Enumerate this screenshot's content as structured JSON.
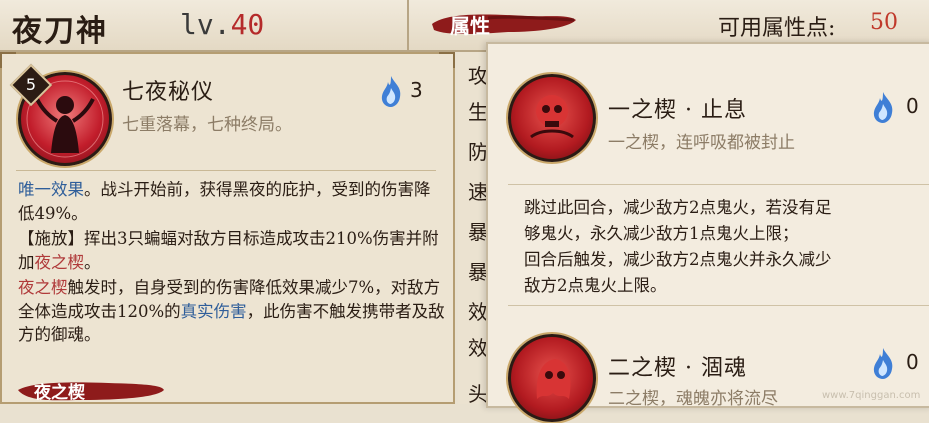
{
  "header": {
    "character_name": "夜刀神",
    "level_label": "lv.",
    "level_value": "40",
    "attributes_tab": "属性",
    "available_points_label": "可用属性点:",
    "available_points_value": "50"
  },
  "skill": {
    "level": "5",
    "name": "七夜秘仪",
    "subtitle": "七重落幕，七种终局。",
    "cost": "3",
    "desc1_keyword": "唯一效果",
    "desc1_rest": "。战斗开始前，获得黑夜的庇护，受到的伤害降低49%。",
    "desc2_a": "【施放】挥出3只蝙蝠对敌方目标造成攻击210%伤害并附加",
    "desc2_keyword": "夜之楔",
    "desc2_b": "。",
    "desc3_keyword": "夜之楔",
    "desc3_a": "触发时，自身受到的伤害降低效果减少7%，对敌方全体造成攻击120%的",
    "desc3_keyword2": "真实伤害",
    "desc3_b": "，此伤害不触发携带者及敌方的御魂。",
    "bottom_tab": "夜之楔"
  },
  "stat_column": [
    "攻",
    "生",
    "防",
    "速",
    "暴",
    "暴",
    "效",
    "效",
    "头"
  ],
  "popup": {
    "item1": {
      "name": "一之楔 · 止息",
      "subtitle": "一之楔，连呼吸都被封止",
      "cost": "0",
      "effect_line1": "跳过此回合，减少敌方2点鬼火，若没有足",
      "effect_line2": "够鬼火，永久减少敌方1点鬼火上限；",
      "effect_line3": "回合后触发，减少敌方2点鬼火并永久减少",
      "effect_line4": "敌方2点鬼火上限。"
    },
    "item2": {
      "name": "二之楔 · 涸魂",
      "subtitle": "二之楔，魂魄亦将流尽",
      "cost": "0"
    }
  },
  "watermark": "www.7qinggan.com",
  "colors": {
    "accent_red": "#b52a2a",
    "keyword_blue": "#2f5e9a",
    "panel_bg": "#ede4d2",
    "popup_bg": "#f3ecdf"
  },
  "icons": {
    "skill_icon": "night-ritual-icon",
    "onibi": "blue-flame-icon",
    "item1_icon": "red-skull-icon",
    "item2_icon": "red-ghost-icon"
  }
}
